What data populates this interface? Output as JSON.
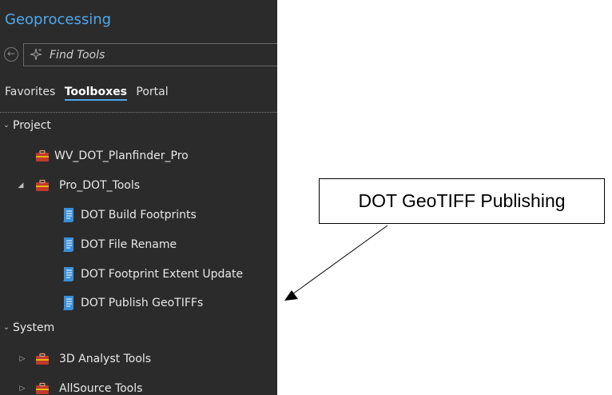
{
  "pane": {
    "title": "Geoprocessing",
    "search_placeholder": "Find Tools",
    "tabs": [
      "Favorites",
      "Toolboxes",
      "Portal"
    ],
    "active_tab": "Toolboxes"
  },
  "tree": {
    "project": {
      "label": "Project",
      "items": {
        "wv": "WV_DOT_Planfinder_Pro",
        "pro": "Pro_DOT_Tools",
        "tools": [
          "DOT Build Footprints",
          "DOT File Rename",
          "DOT Footprint Extent Update",
          "DOT Publish GeoTIFFs"
        ]
      }
    },
    "system": {
      "label": "System",
      "items": [
        "3D Analyst Tools",
        "AllSource Tools"
      ]
    }
  },
  "callout": {
    "text": "DOT GeoTIFF Publishing"
  },
  "colors": {
    "pane_background": "#2b2b2b",
    "title_accent": "#4fa8ec",
    "toolbox_icon": "#c0392b",
    "script_icon": "#3a8fd9"
  }
}
